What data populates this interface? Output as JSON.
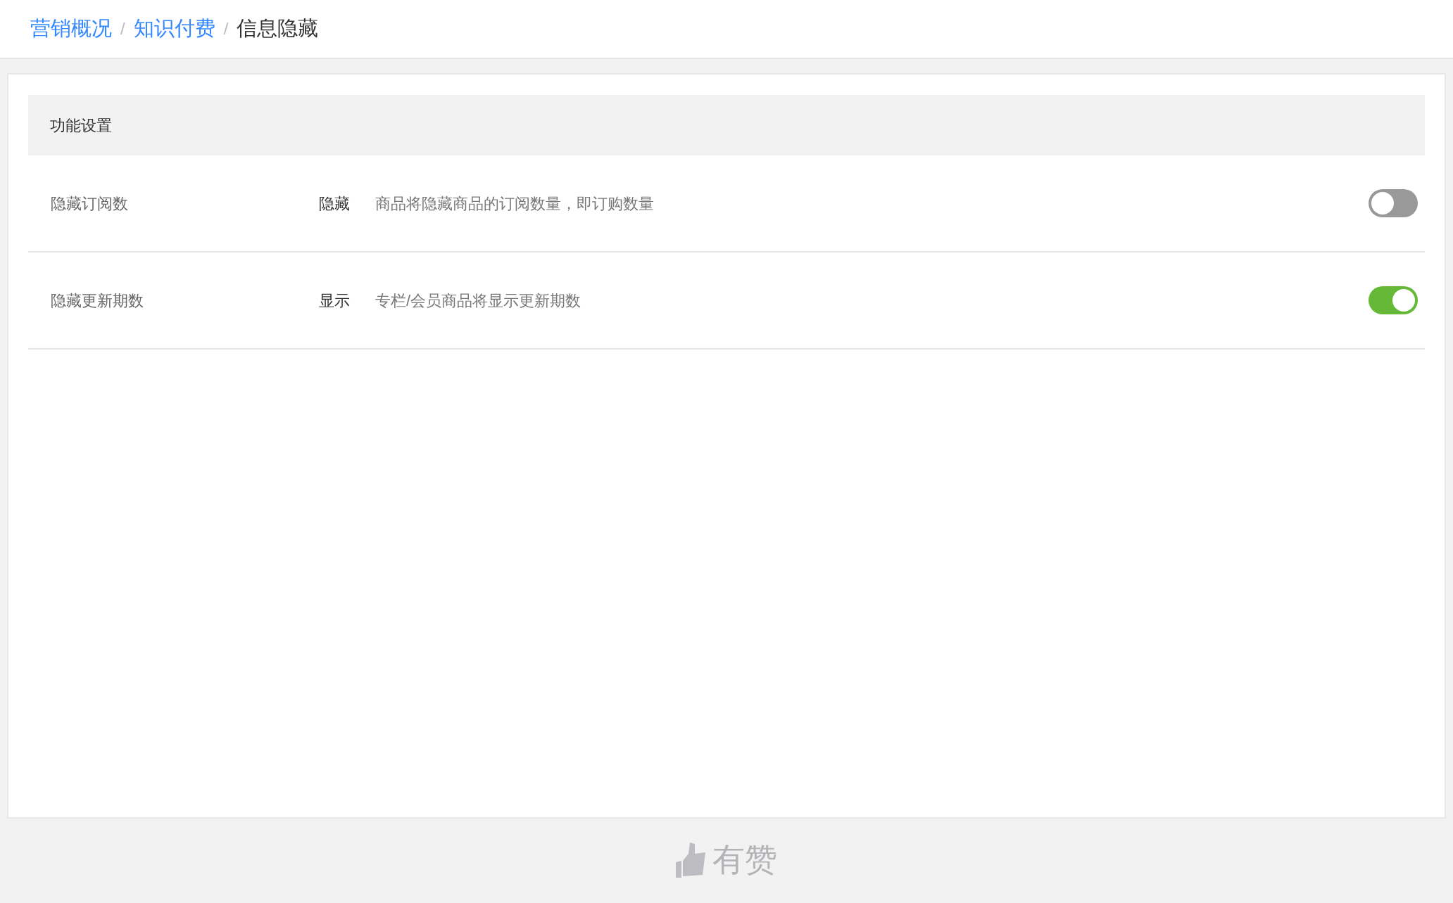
{
  "breadcrumb": [
    {
      "label": "营销概况",
      "kind": "link"
    },
    {
      "label": "知识付费",
      "kind": "link"
    },
    {
      "label": "信息隐藏",
      "kind": "current"
    }
  ],
  "breadcrumb_separator": "/",
  "section": {
    "title": "功能设置"
  },
  "settings": [
    {
      "label": "隐藏订阅数",
      "state_text": "隐藏",
      "description": "商品将隐藏商品的订阅数量，即订购数量",
      "on": false
    },
    {
      "label": "隐藏更新期数",
      "state_text": "显示",
      "description": "专栏/会员商品将显示更新期数",
      "on": true
    }
  ],
  "footer": {
    "logo_text": "有赞"
  }
}
